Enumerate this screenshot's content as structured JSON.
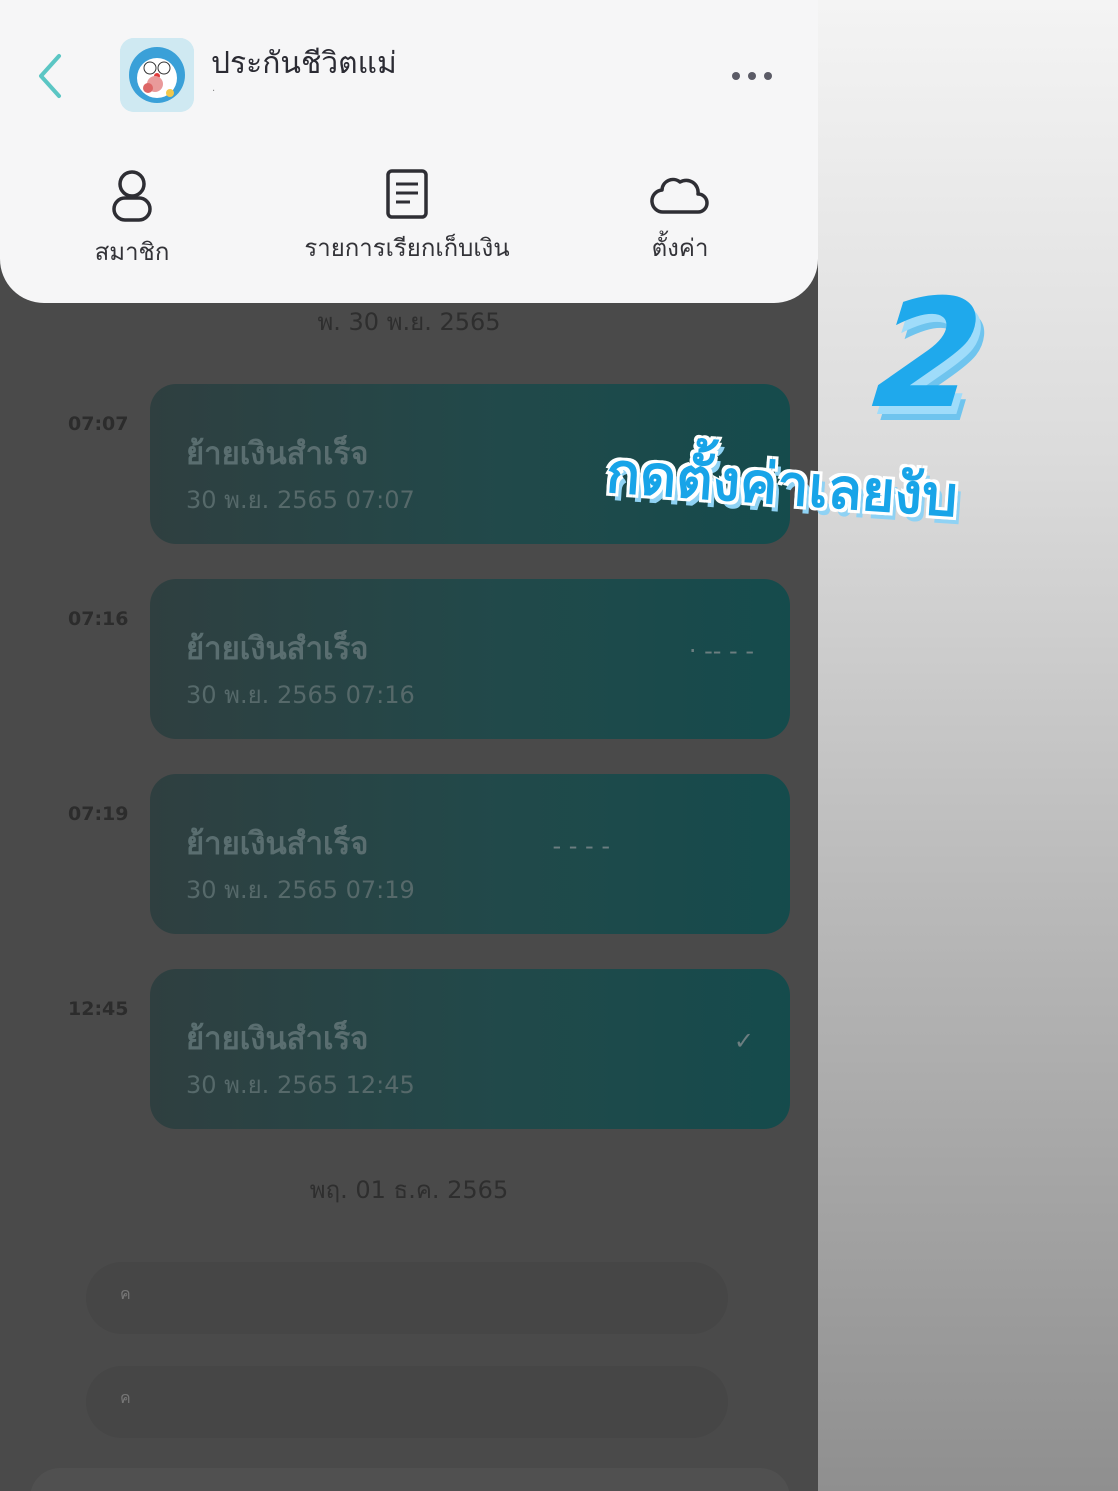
{
  "header": {
    "title": "ประกันชีวิตแม่",
    "subtitle": "·"
  },
  "menu": [
    {
      "label": "สมาชิก",
      "icon": "person-icon"
    },
    {
      "label": "รายการเรียกเก็บเงิน",
      "icon": "document-icon"
    },
    {
      "label": "ตั้งค่า",
      "icon": "cloud-icon"
    }
  ],
  "feed": {
    "date_1": "พ. 30 พ.ย. 2565",
    "date_2": "พฤ. 01 ธ.ค. 2565",
    "items": [
      {
        "time": "07:07",
        "title": "ย้ายเงินสำเร็จ",
        "stamp": "30 พ.ย. 2565 07:07",
        "mark": ""
      },
      {
        "time": "07:16",
        "title": "ย้ายเงินสำเร็จ",
        "stamp": "30 พ.ย. 2565 07:16",
        "mark": "· -- - -"
      },
      {
        "time": "07:19",
        "title": "ย้ายเงินสำเร็จ",
        "stamp": "30 พ.ย. 2565 07:19",
        "mark": "- - - -"
      },
      {
        "time": "12:45",
        "title": "ย้ายเงินสำเร็จ",
        "stamp": "30 พ.ย. 2565 12:45",
        "mark": "✓"
      }
    ],
    "pill_1": "ค",
    "pill_2": "ค"
  },
  "overlay": {
    "step": "2",
    "caption": "กดตั้งค่าเลยงับ"
  },
  "colors": {
    "accent": "#1fa9ec",
    "back_arrow": "#5bc6c4",
    "card": "#21494a"
  }
}
